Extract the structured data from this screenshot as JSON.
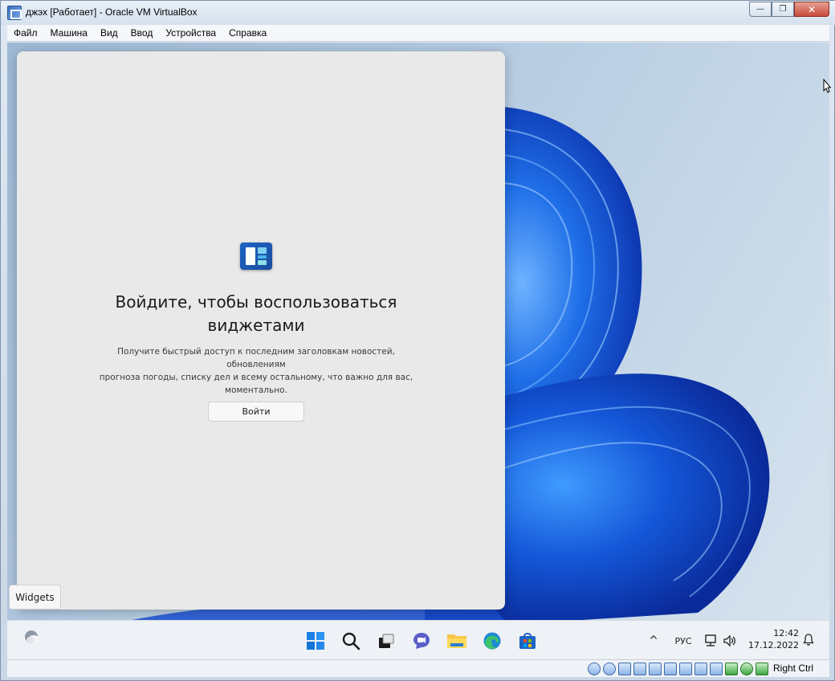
{
  "window": {
    "title": "джэх [Работает] - Oracle VM VirtualBox",
    "minimize_glyph": "—",
    "restore_glyph": "❐",
    "close_glyph": "✕"
  },
  "menu": {
    "items": [
      "Файл",
      "Машина",
      "Вид",
      "Ввод",
      "Устройства",
      "Справка"
    ]
  },
  "widgets_panel": {
    "title_line1": "Войдите, чтобы воспользоваться",
    "title_line2": "виджетами",
    "description_line1": "Получите быстрый доступ к последним заголовкам новостей, обновлениям",
    "description_line2": "прогноза погоды, списку дел и всему остальному, что важно для вас,",
    "description_line3": "моментально.",
    "signin_label": "Войти"
  },
  "tooltip": {
    "text": "Widgets"
  },
  "taskbar": {
    "apps": [
      "start-icon",
      "search-icon",
      "task-view-icon",
      "chat-icon",
      "file-explorer-icon",
      "edge-icon",
      "store-icon"
    ],
    "tray_chevron": "^",
    "language": "РУС",
    "time": "12:42",
    "date": "17.12.2022"
  },
  "statusbar": {
    "host_key": "Right Ctrl",
    "icons": [
      "hard-disk-icon",
      "optical-drive-icon",
      "audio-icon",
      "network-icon",
      "usb-icon",
      "shared-folders-icon",
      "display-icon",
      "screen-capture-icon",
      "video-recording-icon",
      "cpu-icon",
      "mouse-integration-icon",
      "keyboard-icon"
    ]
  },
  "colors": {
    "accent_blue": "#1d63c4",
    "panel_bg": "#e9e9e9",
    "taskbar_bg": "#eef1f5"
  }
}
